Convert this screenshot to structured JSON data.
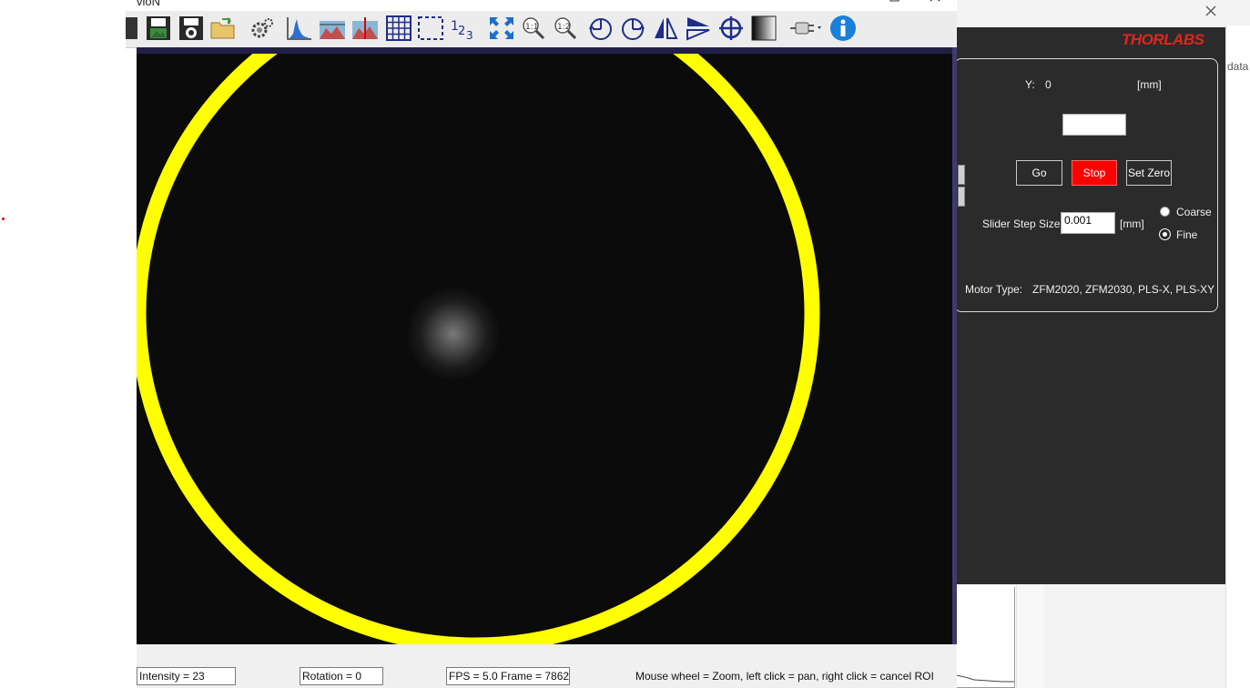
{
  "camera_window": {
    "title_fragment": "vioN",
    "toolbar_icons": [
      "save-image-icon",
      "save-settings-icon",
      "open-folder-icon",
      "settings-icon",
      "histogram-icon",
      "image-profile-icon",
      "color-profile-icon",
      "grid-icon",
      "roi-select-icon",
      "numeric-display-icon",
      "fit-to-window-icon",
      "zoom-1-1-icon",
      "zoom-1-2-icon",
      "rotate-left-icon",
      "rotate-right-icon",
      "flip-horizontal-icon",
      "flip-vertical-icon",
      "crosshair-icon",
      "grayscale-icon",
      "plugin-icon",
      "info-icon"
    ],
    "status": {
      "intensity": "Intensity = 23",
      "rotation": "Rotation = 0",
      "fps_frame": "FPS = 5.0  Frame = 7862",
      "hint": "Mouse wheel = Zoom, left click = pan, right click = cancel ROI"
    },
    "overlay_color": "#ffff00"
  },
  "thorlabs_panel": {
    "logo": "THORLABS",
    "y_label": "Y:",
    "y_value": "0",
    "unit_mm": "[mm]",
    "target_value": "",
    "go_label": "Go",
    "stop_label": "Stop",
    "set_zero_label": "Set Zero",
    "slider_step_label": "Slider Step Size",
    "slider_step_value": "0.001",
    "slider_unit": "[mm]",
    "coarse_label": "Coarse",
    "fine_label": "Fine",
    "selected_step_mode": "Fine",
    "motor_type_label": "Motor Type:",
    "motor_type_value": "ZFM2020, ZFM2030, PLS-X, PLS-XY",
    "accent_color": "#ff0000"
  },
  "background_window": {
    "data_label": "data"
  }
}
